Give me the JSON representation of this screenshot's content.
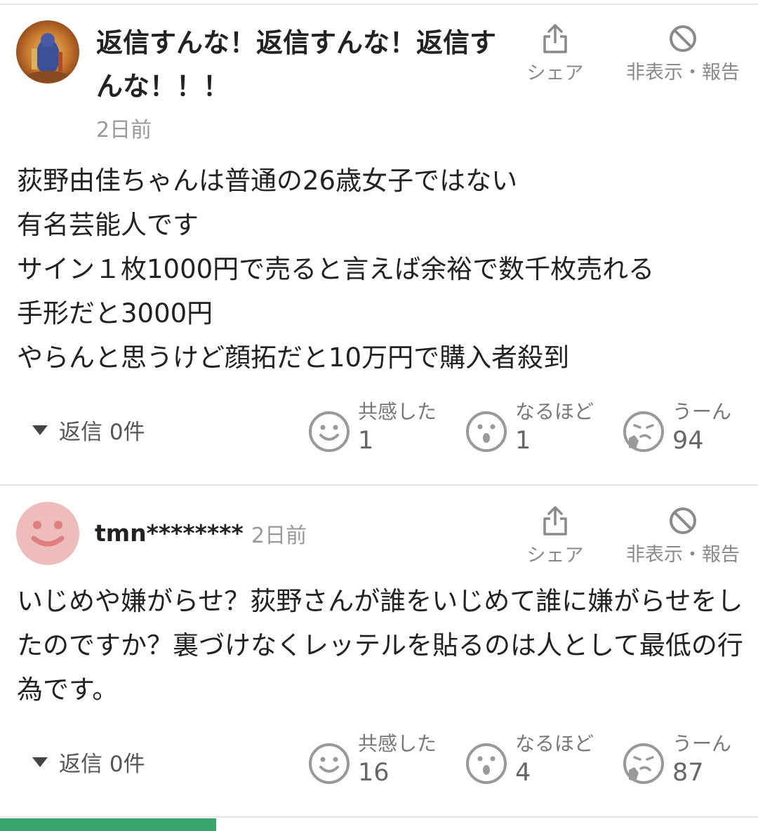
{
  "comments": [
    {
      "username": "返信すんな！返信すんな！返信すんな！！！",
      "time": "2日前",
      "share_label": "シェア",
      "hide_label": "非表示・報告",
      "body": "荻野由佳ちゃんは普通の26歳女子ではない\n有名芸能人です\nサイン１枚1000円で売ると言えば余裕で数千枚売れる\n手形だと3000円\nやらんと思うけど顔拓だと10万円で購入者殺到",
      "replies": "返信 0件",
      "reactions": [
        {
          "label": "共感した",
          "count": "1",
          "icon": "smile-icon"
        },
        {
          "label": "なるほど",
          "count": "1",
          "icon": "surprised-icon"
        },
        {
          "label": "うーん",
          "count": "94",
          "icon": "thinking-icon"
        }
      ]
    },
    {
      "username": "tmn********",
      "time": "2日前",
      "share_label": "シェア",
      "hide_label": "非表示・報告",
      "body": "いじめや嫌がらせ？荻野さんが誰をいじめて誰に嫌がらせをしたのですか？裏づけなくレッテルを貼るのは人として最低の行為です。",
      "replies": "返信 0件",
      "reactions": [
        {
          "label": "共感した",
          "count": "16",
          "icon": "smile-icon"
        },
        {
          "label": "なるほど",
          "count": "4",
          "icon": "surprised-icon"
        },
        {
          "label": "うーん",
          "count": "87",
          "icon": "thinking-icon"
        }
      ]
    }
  ],
  "colors": {
    "accent_green": "#3aa56b",
    "avatar_pink": "#efbcbc",
    "icon_gray": "#8a8a8a"
  }
}
